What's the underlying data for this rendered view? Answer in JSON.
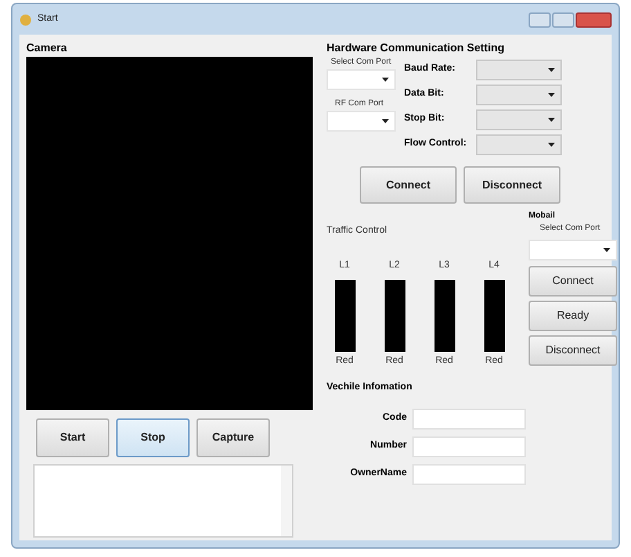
{
  "window": {
    "title": "Start"
  },
  "camera": {
    "label": "Camera"
  },
  "camera_buttons": [
    {
      "label": "Start",
      "focused": false
    },
    {
      "label": "Stop",
      "focused": true
    },
    {
      "label": "Capture",
      "focused": false
    }
  ],
  "hardware": {
    "title": "Hardware Communication Setting",
    "com_port_label": "Select Com Port",
    "rf_port_label": "RF Com Port",
    "settings": [
      {
        "label": "Baud Rate:"
      },
      {
        "label": "Data Bit:"
      },
      {
        "label": "Stop Bit:"
      },
      {
        "label": "Flow Control:"
      }
    ],
    "buttons": [
      "Connect",
      "Disconnect"
    ]
  },
  "traffic": {
    "title": "Traffic Control",
    "lights": [
      {
        "label": "L1",
        "status": "Red"
      },
      {
        "label": "L2",
        "status": "Red"
      },
      {
        "label": "L3",
        "status": "Red"
      },
      {
        "label": "L4",
        "status": "Red"
      }
    ]
  },
  "mobile": {
    "title": "Mobail",
    "port_label": "Select Com Port",
    "buttons": [
      "Connect",
      "Ready",
      "Disconnect"
    ]
  },
  "vehicle": {
    "title": "Vechile  Infomation",
    "fields": [
      {
        "label": "Code"
      },
      {
        "label": "Number"
      },
      {
        "label": "OwnerName"
      }
    ]
  }
}
